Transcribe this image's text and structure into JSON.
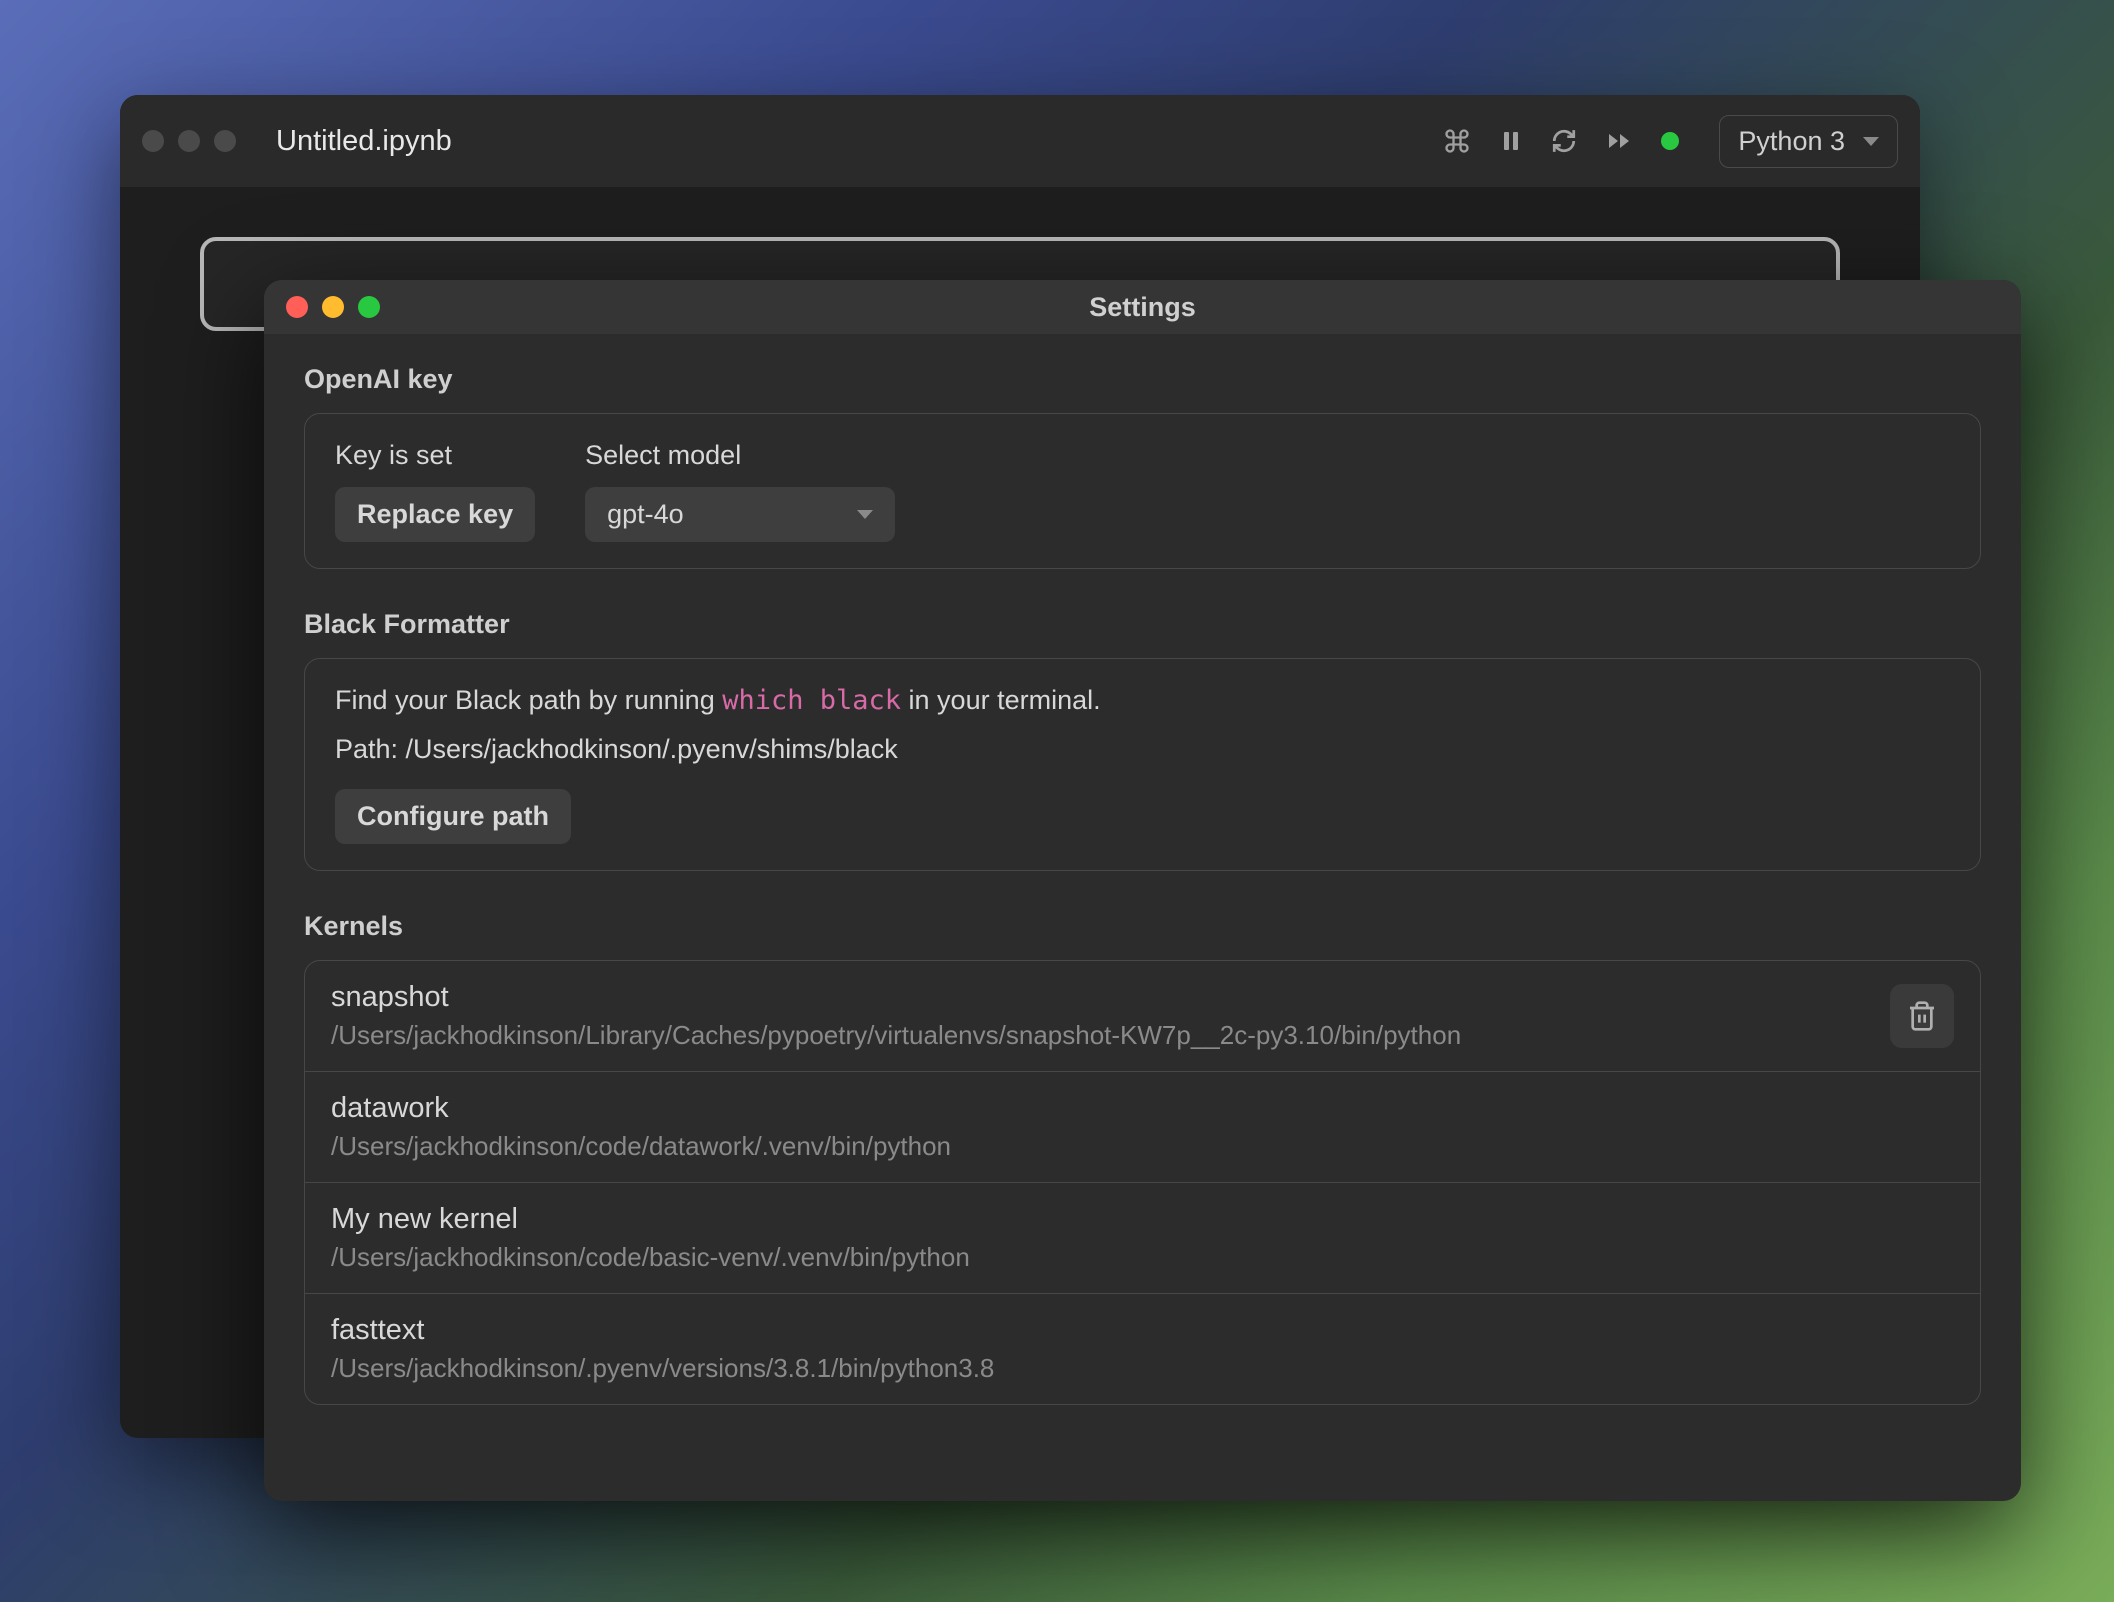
{
  "main": {
    "title": "Untitled.ipynb",
    "kernel_dropdown": "Python 3"
  },
  "settings": {
    "title": "Settings",
    "openai": {
      "section_label": "OpenAI key",
      "key_label": "Key is set",
      "replace_button": "Replace key",
      "model_label": "Select model",
      "model_value": "gpt-4o"
    },
    "black": {
      "section_label": "Black Formatter",
      "instruction_prefix": "Find your Black path by running ",
      "instruction_code": "which black",
      "instruction_suffix": " in your terminal.",
      "path_label": "Path: ",
      "path_value": "/Users/jackhodkinson/.pyenv/shims/black",
      "configure_button": "Configure path"
    },
    "kernels": {
      "section_label": "Kernels",
      "items": [
        {
          "name": "snapshot",
          "path": "/Users/jackhodkinson/Library/Caches/pypoetry/virtualenvs/snapshot-KW7p__2c-py3.10/bin/python"
        },
        {
          "name": "datawork",
          "path": "/Users/jackhodkinson/code/datawork/.venv/bin/python"
        },
        {
          "name": "My new kernel",
          "path": "/Users/jackhodkinson/code/basic-venv/.venv/bin/python"
        },
        {
          "name": "fasttext",
          "path": "/Users/jackhodkinson/.pyenv/versions/3.8.1/bin/python3.8"
        }
      ]
    }
  }
}
